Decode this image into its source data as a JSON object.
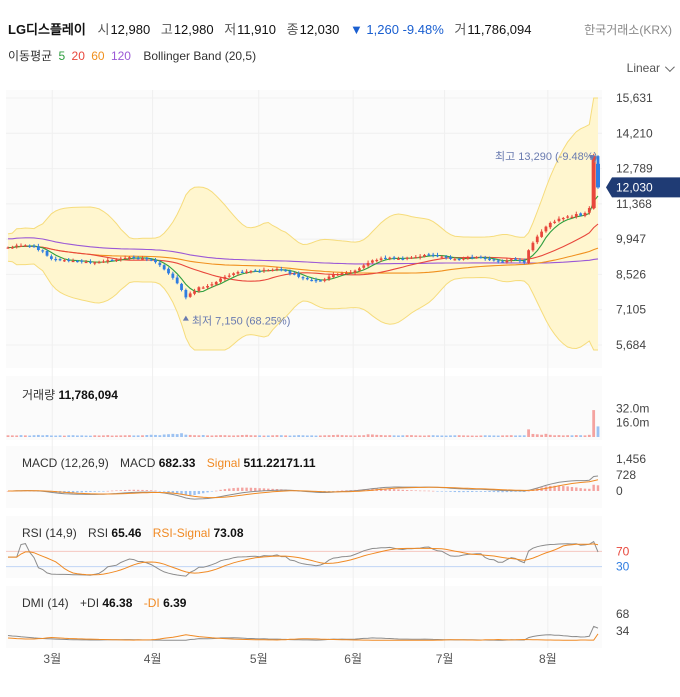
{
  "header": {
    "stock_name": "LG디스플레이",
    "open_label": "시",
    "open": "12,980",
    "high_label": "고",
    "high": "12,980",
    "low_label": "저",
    "low": "11,910",
    "close_label": "종",
    "close": "12,030",
    "change": "▼ 1,260",
    "change_pct": "-9.48%",
    "volume_label": "거",
    "volume": "11,786,094",
    "exchange": "한국거래소(KRX)"
  },
  "indicators": {
    "ma_label": "이동평균",
    "ma_periods": [
      "5",
      "20",
      "60",
      "120"
    ],
    "ma_colors": [
      "#2e9e3e",
      "#e8473c",
      "#f0901e",
      "#9b59d6"
    ],
    "bollinger": "Bollinger Band (20,5)"
  },
  "scale_button": "Linear",
  "colors": {
    "up": "#e8473c",
    "down": "#2f7de1",
    "band_fill": "#fff6cf",
    "band_line": "#f6dc7c",
    "macd": "#8c8c8c",
    "signal": "#f08a24",
    "di_plus": "#8c8c8c",
    "di_minus": "#f08a24"
  },
  "chart_data": [
    {
      "type": "candlestick",
      "x_ticks": [
        "3월",
        "4월",
        "5월",
        "6월",
        "7월",
        "8월"
      ],
      "y_ticks": [
        "15,631",
        "14,210",
        "12,789",
        "11,368",
        "9,947",
        "8,526",
        "7,105",
        "5,684"
      ],
      "ylim": [
        5684,
        15631
      ],
      "last_price": "12,030",
      "high_annotation": "최고 13,290 (-9.48%)",
      "low_annotation": "최저 7,150 (68.25%)",
      "closes": [
        9610,
        9620,
        9690,
        9680,
        9700,
        9670,
        9640,
        9510,
        9460,
        9280,
        9150,
        9120,
        9100,
        9100,
        9090,
        9070,
        9060,
        9040,
        9030,
        9000,
        9010,
        9020,
        9050,
        9100,
        9110,
        9120,
        9160,
        9190,
        9220,
        9210,
        9170,
        9170,
        9140,
        9100,
        9020,
        8900,
        8730,
        8570,
        8390,
        8170,
        7900,
        7600,
        7760,
        7850,
        8010,
        8000,
        8060,
        8130,
        8220,
        8360,
        8430,
        8480,
        8570,
        8620,
        8630,
        8640,
        8660,
        8670,
        8650,
        8710,
        8700,
        8710,
        8750,
        8690,
        8690,
        8560,
        8530,
        8430,
        8370,
        8330,
        8300,
        8260,
        8280,
        8330,
        8440,
        8520,
        8540,
        8580,
        8590,
        8610,
        8680,
        8770,
        8890,
        8990,
        9090,
        9110,
        9170,
        9170,
        9200,
        9180,
        9160,
        9150,
        9200,
        9210,
        9230,
        9250,
        9310,
        9330,
        9290,
        9260,
        9250,
        9200,
        9150,
        9140,
        9150,
        9180,
        9200,
        9210,
        9220,
        9220,
        9150,
        9110,
        9100,
        9040,
        9040,
        9090,
        9140,
        9120,
        9060,
        9010,
        9500,
        9800,
        10050,
        10250,
        10450,
        10600,
        10650,
        10770,
        10800,
        10860,
        10850,
        10960,
        10900,
        11000,
        11200,
        13290,
        12030
      ],
      "volume_ticks": [
        "32.0m",
        "16.0m"
      ],
      "volume_ylim": [
        0,
        39000000
      ],
      "volume_label": "거래량",
      "volume": "11,786,094",
      "volumes_m": [
        1.9,
        1.8,
        1.7,
        2.1,
        1.8,
        1.6,
        2.0,
        2.3,
        1.9,
        2.2,
        1.7,
        1.6,
        1.8,
        1.5,
        1.9,
        2.0,
        1.7,
        1.8,
        1.6,
        1.5,
        1.9,
        1.7,
        1.8,
        2.1,
        1.6,
        1.7,
        1.8,
        1.9,
        2.0,
        1.7,
        1.8,
        1.9,
        2.2,
        2.5,
        2.3,
        2.0,
        2.8,
        3.1,
        3.5,
        3.2,
        4.2,
        2.6,
        2.3,
        2.0,
        1.9,
        2.2,
        1.8,
        1.7,
        1.9,
        2.1,
        2.0,
        1.8,
        1.7,
        1.9,
        2.2,
        2.4,
        2.0,
        1.9,
        1.8,
        1.6,
        1.7,
        1.9,
        2.1,
        2.0,
        1.8,
        1.6,
        1.8,
        2.1,
        1.9,
        1.7,
        1.8,
        1.6,
        1.7,
        1.9,
        2.0,
        2.2,
        2.5,
        2.1,
        1.9,
        1.8,
        1.7,
        1.9,
        2.0,
        3.0,
        2.8,
        2.4,
        2.2,
        1.9,
        2.0,
        1.8,
        1.7,
        1.9,
        2.0,
        2.1,
        1.8,
        1.7,
        1.6,
        1.9,
        2.0,
        1.8,
        1.7,
        1.6,
        1.8,
        1.9,
        2.0,
        1.8,
        1.7,
        1.6,
        1.5,
        1.7,
        1.9,
        1.8,
        1.7,
        1.6,
        1.8,
        1.9,
        2.0,
        1.7,
        1.8,
        1.9,
        8.5,
        3.4,
        3.0,
        2.5,
        3.5,
        2.4,
        1.9,
        2.1,
        1.8,
        2.0,
        1.9,
        2.1,
        2.0,
        1.8,
        2.4,
        30.0,
        11.8
      ]
    },
    {
      "type": "line",
      "name": "MACD (12,26,9)",
      "series": [
        {
          "name": "MACD",
          "value": "682.33"
        },
        {
          "name": "Signal",
          "value": "511.22171.11"
        }
      ],
      "y_ticks": [
        "1,456",
        "728",
        "0"
      ],
      "ylim": [
        -550,
        1600
      ]
    },
    {
      "type": "line",
      "name": "RSI (14,9)",
      "series": [
        {
          "name": "RSI",
          "value": "65.46"
        },
        {
          "name": "RSI-Signal",
          "value": "73.08"
        }
      ],
      "y_ticks": [
        "70",
        "30"
      ],
      "ylim": [
        0,
        100
      ]
    },
    {
      "type": "line",
      "name": "DMI (14)",
      "series": [
        {
          "name": "+DI",
          "value": "46.38"
        },
        {
          "name": "-DI",
          "value": "6.39"
        }
      ],
      "y_ticks": [
        "68",
        "34"
      ],
      "ylim": [
        0,
        100
      ]
    }
  ]
}
